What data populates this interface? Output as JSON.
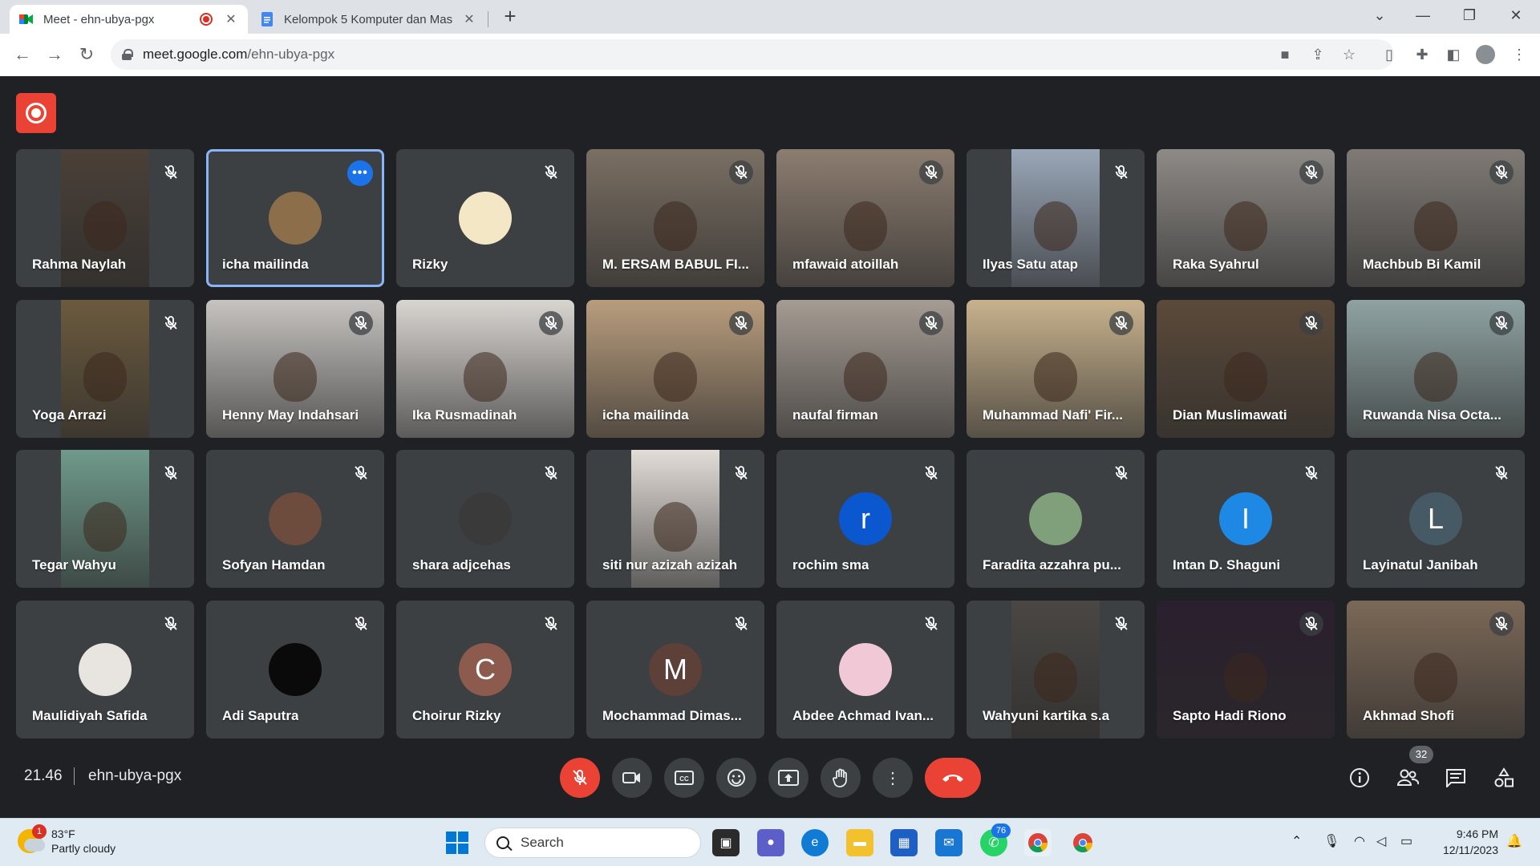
{
  "browser": {
    "tabs": [
      {
        "title": "Meet - ehn-ubya-pgx",
        "active": true,
        "recording": true
      },
      {
        "title": "Kelompok 5 Komputer dan Mas",
        "active": false
      }
    ],
    "url_host": "meet.google.com",
    "url_path": "/ehn-ubya-pgx"
  },
  "meeting": {
    "time": "21.46",
    "code": "ehn-ubya-pgx",
    "participant_count": "32",
    "recording": true
  },
  "participants": [
    {
      "name": "Rahma Naylah",
      "kind": "video",
      "cam_color": "#4a4038"
    },
    {
      "name": "icha mailinda",
      "kind": "avatar",
      "avatar_color": "#8d6e4a",
      "speaking": true
    },
    {
      "name": "Rizky",
      "kind": "avatar",
      "avatar_color": "#f3e7c5"
    },
    {
      "name": "M. ERSAM BABUL FI...",
      "kind": "video",
      "cam_color": "#7a6f63"
    },
    {
      "name": "mfawaid atoillah",
      "kind": "video",
      "cam_color": "#8c7d70"
    },
    {
      "name": "Ilyas Satu atap",
      "kind": "video",
      "cam_color": "#9aa7b8"
    },
    {
      "name": "Raka Syahrul",
      "kind": "video",
      "cam_color": "#8e8a86"
    },
    {
      "name": "Machbub Bi Kamil",
      "kind": "video",
      "cam_color": "#7f7a75"
    },
    {
      "name": "Yoga Arrazi",
      "kind": "video",
      "cam_color": "#6b5a3e"
    },
    {
      "name": "Henny May Indahsari",
      "kind": "video",
      "cam_color": "#c6c3c0"
    },
    {
      "name": "Ika Rusmadinah",
      "kind": "video",
      "cam_color": "#d9d5d1"
    },
    {
      "name": "icha mailinda",
      "kind": "video",
      "cam_color": "#b99d7d"
    },
    {
      "name": "naufal firman",
      "kind": "video",
      "cam_color": "#a59c93"
    },
    {
      "name": "Muhammad Nafi' Fir...",
      "kind": "video",
      "cam_color": "#c8b28d"
    },
    {
      "name": "Dian Muslimawati",
      "kind": "video",
      "cam_color": "#5b4a3a"
    },
    {
      "name": "Ruwanda Nisa Octa...",
      "kind": "video",
      "cam_color": "#8fa3a2"
    },
    {
      "name": "Tegar Wahyu",
      "kind": "video",
      "cam_color": "#6f9a8c"
    },
    {
      "name": "Sofyan Hamdan",
      "kind": "avatar",
      "avatar_color": "#6d4c3d"
    },
    {
      "name": "shara adjcehas",
      "kind": "avatar",
      "avatar_color": "#3a3a3a"
    },
    {
      "name": "siti nur azizah azizah",
      "kind": "video",
      "cam_color": "#e3ddd8"
    },
    {
      "name": "rochim sma",
      "kind": "letter",
      "letter": "r",
      "avatar_color": "#0b57d0"
    },
    {
      "name": "Faradita azzahra pu...",
      "kind": "avatar",
      "avatar_color": "#7fa07a"
    },
    {
      "name": "Intan D. Shaguni",
      "kind": "letter",
      "letter": "I",
      "avatar_color": "#1e88e5"
    },
    {
      "name": "Layinatul Janibah",
      "kind": "letter",
      "letter": "L",
      "avatar_color": "#455a64"
    },
    {
      "name": "Maulidiyah Safida",
      "kind": "avatar",
      "avatar_color": "#e8e4df"
    },
    {
      "name": "Adi Saputra",
      "kind": "avatar",
      "avatar_color": "#0a0a0a"
    },
    {
      "name": "Choirur Rizky",
      "kind": "letter",
      "letter": "C",
      "avatar_color": "#8d5a4e"
    },
    {
      "name": "Mochammad Dimas...",
      "kind": "letter",
      "letter": "M",
      "avatar_color": "#5d4037"
    },
    {
      "name": "Abdee Achmad Ivan...",
      "kind": "avatar",
      "avatar_color": "#f1c9d6"
    },
    {
      "name": "Wahyuni kartika s.a",
      "kind": "video",
      "cam_color": "#4a4744"
    },
    {
      "name": "Sapto Hadi Riono",
      "kind": "video",
      "cam_color": "#2a1f2e"
    },
    {
      "name": "Akhmad Shofi",
      "kind": "video",
      "cam_color": "#7b6857"
    }
  ],
  "controls": {
    "mic": "mic-off-icon",
    "camera": "camera-icon",
    "captions": "captions-icon",
    "reactions": "emoji-icon",
    "present": "present-icon",
    "hand": "raise-hand-icon",
    "more": "more-options-icon",
    "leave": "leave-call-icon"
  },
  "taskbar": {
    "temperature": "83°F",
    "weather": "Partly cloudy",
    "weather_badge": "1",
    "search_placeholder": "Search",
    "whatsapp_badge": "76",
    "time": "9:46 PM",
    "date": "12/11/2023"
  }
}
